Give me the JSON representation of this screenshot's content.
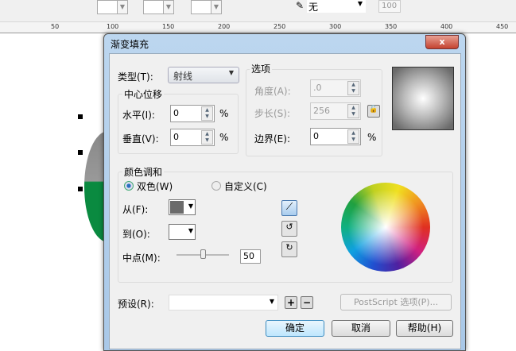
{
  "toolbar": {
    "outline_value": "无",
    "size_value": "100"
  },
  "ruler": {
    "labels": [
      "50",
      "100",
      "150",
      "200",
      "250",
      "300",
      "350",
      "400",
      "450"
    ]
  },
  "dialog": {
    "title": "渐变填充",
    "close_label": "x",
    "type_label": "类型(T):",
    "type_value": "射线",
    "center_offset": {
      "title": "中心位移",
      "horizontal_label": "水平(I):",
      "horizontal_value": "0",
      "vertical_label": "垂直(V):",
      "vertical_value": "0",
      "unit": "%"
    },
    "options": {
      "title": "选项",
      "angle_label": "角度(A):",
      "angle_value": ".0",
      "steps_label": "步长(S):",
      "steps_value": "256",
      "edge_label": "边界(E):",
      "edge_value": "0",
      "unit": "%"
    },
    "color_blend": {
      "title": "颜色调和",
      "two_color_label": "双色(W)",
      "custom_label": "自定义(C)",
      "selected": "two_color",
      "from_label": "从(F):",
      "from_color": "#6b6b6b",
      "to_label": "到(O):",
      "to_color": "#ffffff",
      "midpoint_label": "中点(M):",
      "midpoint_value": "50"
    },
    "preset_label": "预设(R):",
    "preset_value": "",
    "postscript_label": "PostScript 选项(P)...",
    "ok_label": "确定",
    "cancel_label": "取消",
    "help_label": "帮助(H)"
  }
}
